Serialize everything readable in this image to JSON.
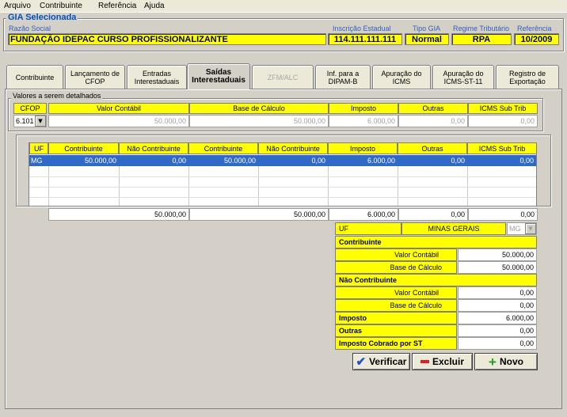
{
  "menu": [
    "Arquivo",
    "Contribuinte",
    "Referência",
    "Ajuda"
  ],
  "gia": {
    "title": "GIA Selecionada",
    "razao_label": "Razão Social",
    "razao_value": "FUNDAÇÃO IDEPAC CURSO PROFISSIONALIZANTE",
    "ie_label": "Inscrição Estadual",
    "ie_value": "114.111.111.111",
    "tipo_label": "Tipo GIA",
    "tipo_value": "Normal",
    "regime_label": "Regime Tributário",
    "regime_value": "RPA",
    "ref_label": "Referência",
    "ref_value": "10/2009"
  },
  "tabs": [
    {
      "label": "Contribuinte"
    },
    {
      "label": "Lançamento de CFOP"
    },
    {
      "label": "Entradas Interestaduais"
    },
    {
      "label": "Saídas Interestaduais"
    },
    {
      "label": "ZFM/ALC"
    },
    {
      "label": "Inf. para a DIPAM-B"
    },
    {
      "label": "Apuração do ICMS"
    },
    {
      "label": "Apuração do ICMS-ST-11"
    },
    {
      "label": "Registro de Exportação"
    }
  ],
  "valores": {
    "title": "Valores a serem detalhados",
    "headers": [
      "CFOP",
      "Valor Contábil",
      "Base de Cálculo",
      "Imposto",
      "Outras",
      "ICMS Sub Trib"
    ],
    "cfop": "6.101",
    "values": [
      "50.000,00",
      "50.000,00",
      "6.000,00",
      "0,00",
      "0,00"
    ]
  },
  "grid": {
    "headers": [
      "UF",
      "Contribuinte",
      "Não Contribuinte",
      "Contribuinte",
      "Não Contribuinte",
      "Imposto",
      "Outras",
      "ICMS Sub Trib"
    ],
    "rows": [
      [
        "MG",
        "50.000,00",
        "0,00",
        "50.000,00",
        "0,00",
        "6.000,00",
        "0,00",
        "0,00"
      ]
    ]
  },
  "totals": [
    "50.000,00",
    "50.000,00",
    "6.000,00",
    "0,00",
    "0,00"
  ],
  "detail": {
    "uf_label": "UF",
    "uf_name": "MINAS GERAIS",
    "uf_code": "MG",
    "contribuinte": "Contribuinte",
    "valor_contabil": "Valor Contábil",
    "base_calculo": "Base de Cálculo",
    "contrib_vc": "50.000,00",
    "contrib_bc": "50.000,00",
    "nao_contribuinte": "Não Contribuinte",
    "nao_vc": "0,00",
    "nao_bc": "0,00",
    "imposto_label": "Imposto",
    "imposto_value": "6.000,00",
    "outras_label": "Outras",
    "outras_value": "0,00",
    "st_label": "Imposto Cobrado por ST",
    "st_value": "0,00"
  },
  "buttons": {
    "verificar": "Verificar",
    "excluir": "Excluir",
    "novo": "Novo"
  },
  "colors": {
    "yellow": "#ffff00",
    "selection": "#3169c6",
    "title_blue": "#0050c0"
  }
}
